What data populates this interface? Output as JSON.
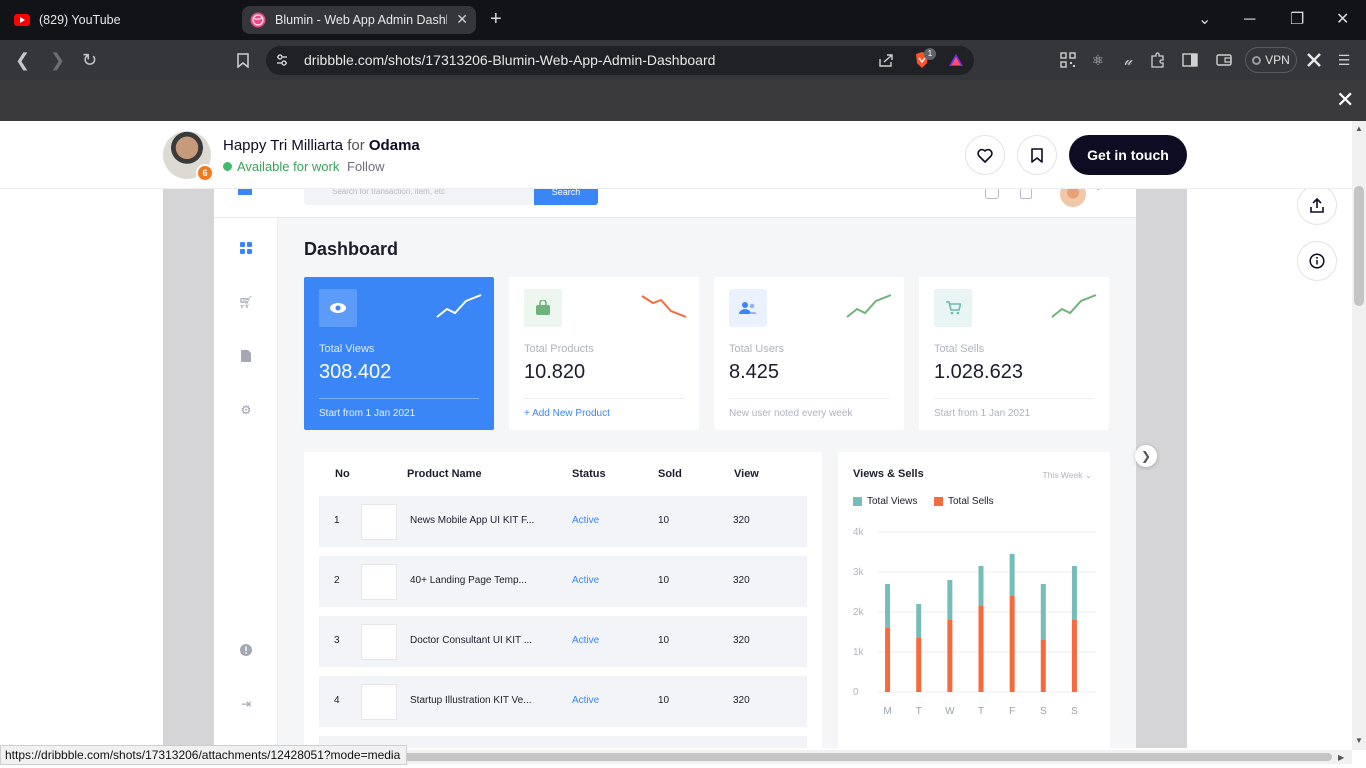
{
  "browser": {
    "tabs": [
      {
        "title": "(829) YouTube"
      },
      {
        "title": "Blumin - Web App Admin Dashboard"
      }
    ],
    "url": "dribbble.com/shots/17313206-Blumin-Web-App-Admin-Dashboard",
    "vpn_label": "VPN",
    "brave_badge": "1",
    "status_url": "https://dribbble.com/shots/17313206/attachments/12428051?mode=media"
  },
  "shot_header": {
    "author": "Happy Tri Milliarta",
    "for_label": "for",
    "team": "Odama",
    "availability": "Available for work",
    "follow_label": "Follow",
    "get_in_touch_label": "Get in touch",
    "avatar_badge": "6"
  },
  "dashboard": {
    "search_placeholder": "Search for transaction, item, etc",
    "search_button": "Search",
    "title": "Dashboard",
    "stats": [
      {
        "label": "Total Views",
        "value": "308.402",
        "footer": "Start from 1 Jan 2021",
        "color": "#3b86f7"
      },
      {
        "label": "Total Products",
        "value": "10.820",
        "footer": "+ Add New Product",
        "color": "#6db37a"
      },
      {
        "label": "Total Users",
        "value": "8.425",
        "footer": "New user noted every week",
        "color": "#3b86f7"
      },
      {
        "label": "Total Sells",
        "value": "1.028.623",
        "footer": "Start from 1 Jan 2021",
        "color": "#6cb9ad"
      }
    ],
    "table": {
      "headers": [
        "No",
        "Product Name",
        "Status",
        "Sold",
        "View"
      ],
      "rows": [
        {
          "no": "1",
          "name": "News Mobile App UI KIT F...",
          "status": "Active",
          "sold": "10",
          "view": "320"
        },
        {
          "no": "2",
          "name": "40+ Landing Page Temp...",
          "status": "Active",
          "sold": "10",
          "view": "320"
        },
        {
          "no": "3",
          "name": "Doctor Consultant UI KIT ...",
          "status": "Active",
          "sold": "10",
          "view": "320"
        },
        {
          "no": "4",
          "name": "Startup Illustration KIT Ve...",
          "status": "Active",
          "sold": "10",
          "view": "320"
        }
      ]
    },
    "views_sells": {
      "title": "Views & Sells",
      "period": "This Week",
      "legend": [
        "Total Views",
        "Total Sells"
      ],
      "y_ticks": [
        "4k",
        "3k",
        "2k",
        "1k",
        "0"
      ]
    }
  },
  "chart_data": {
    "type": "bar",
    "stacked": true,
    "categories": [
      "M",
      "T",
      "W",
      "T",
      "F",
      "S",
      "S"
    ],
    "series": [
      {
        "name": "Total Sells",
        "color": "#f56b3d",
        "values": [
          1.6,
          1.35,
          1.8,
          2.15,
          2.4,
          1.3,
          1.8
        ]
      },
      {
        "name": "Total Views",
        "color": "#76bcb8",
        "values": [
          1.1,
          0.85,
          1.0,
          1.0,
          1.05,
          1.4,
          1.35
        ]
      }
    ],
    "ylabel": "",
    "ylim": [
      0,
      4
    ],
    "y_unit": "k",
    "grid": true,
    "legend": "top-left"
  },
  "colors": {
    "accent": "#3b86f7",
    "dribbble_dark": "#0d0c22",
    "available_green": "#3aa35b"
  }
}
